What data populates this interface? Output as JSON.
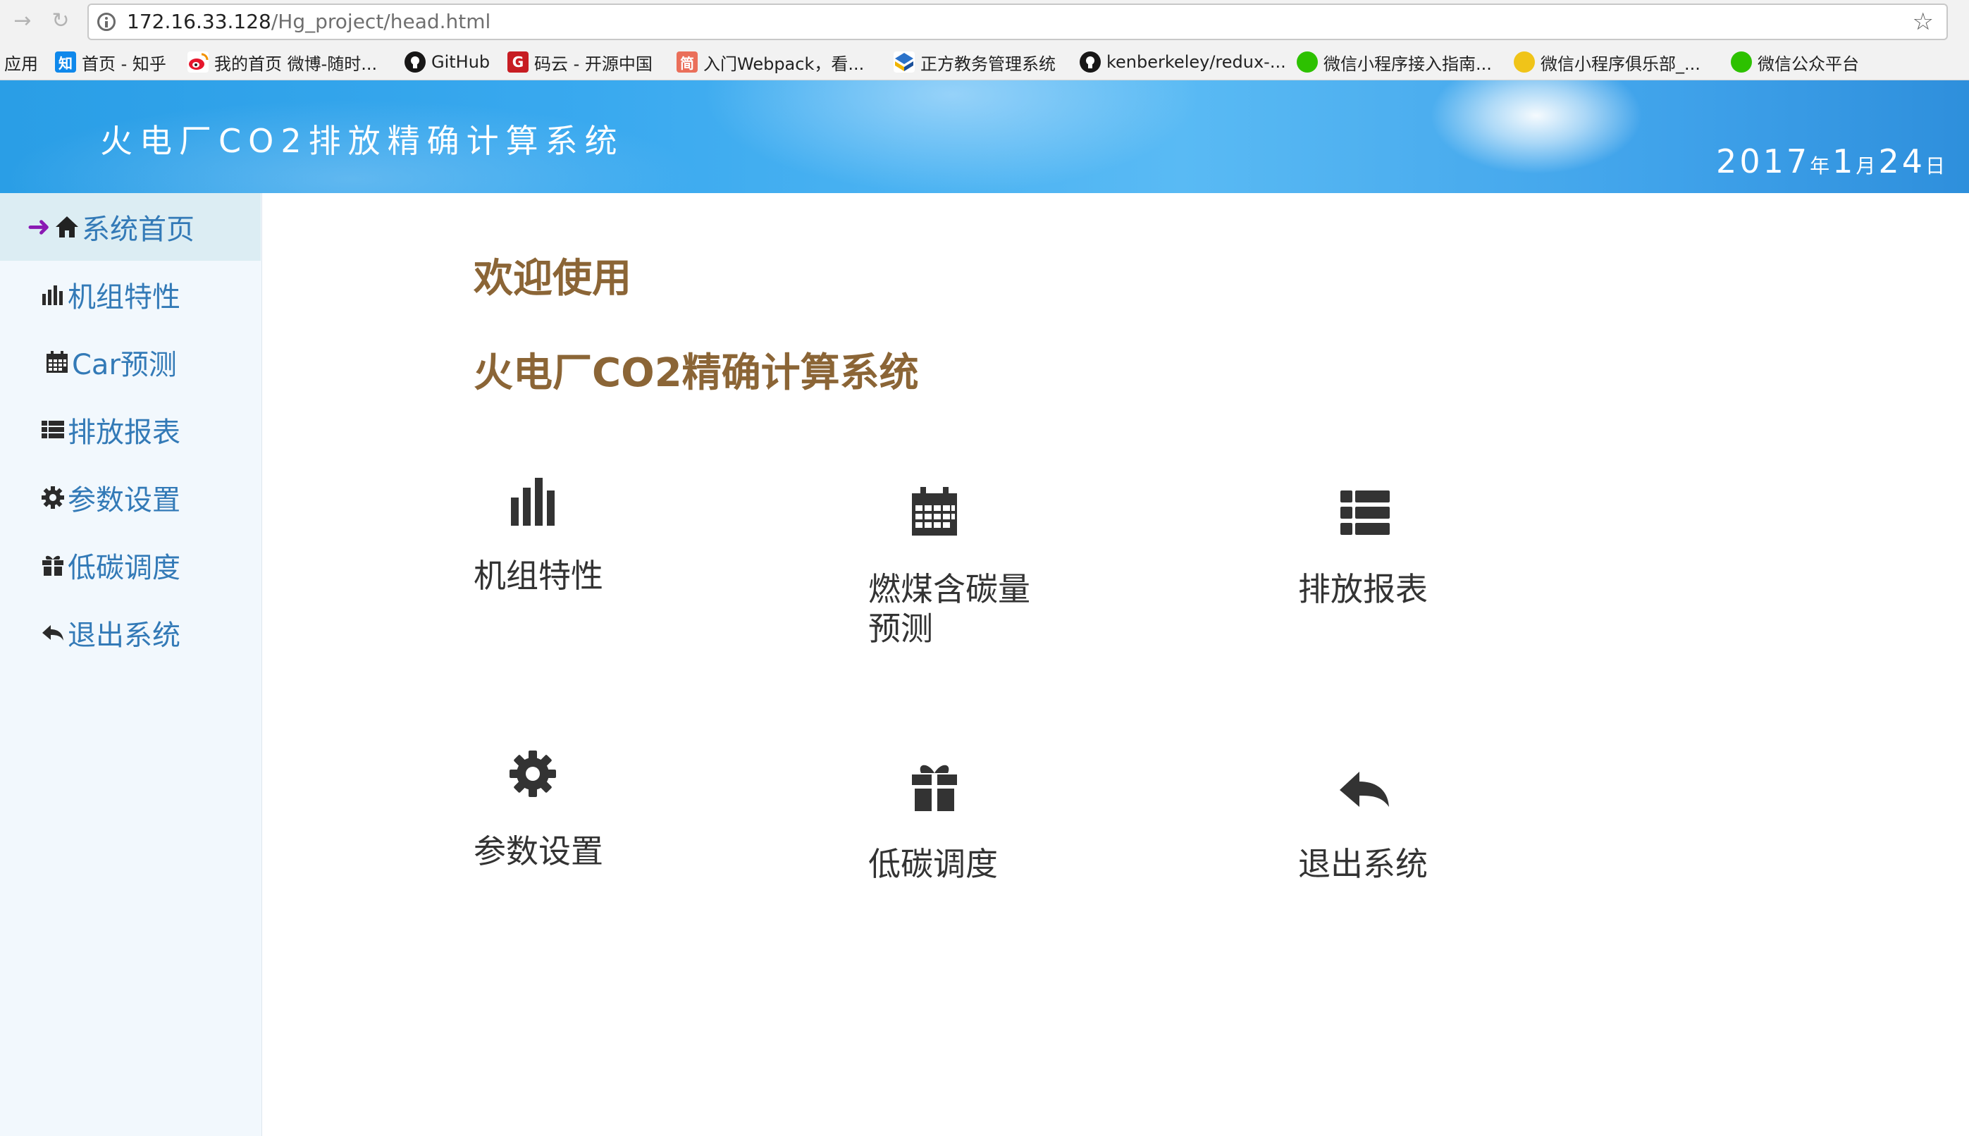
{
  "browser": {
    "url_host": "172.16.33.128",
    "url_path": "/Hg_project/head.html",
    "bookmarks": [
      {
        "label": "应用",
        "icon": "apps-grid-icon"
      },
      {
        "label": "首页 - 知乎",
        "icon": "zhihu-icon",
        "color": "#0f88eb"
      },
      {
        "label": "我的首页 微博-随时...",
        "icon": "weibo-icon",
        "color": "#e6162d"
      },
      {
        "label": "GitHub",
        "icon": "github-icon",
        "color": "#181717"
      },
      {
        "label": "码云 - 开源中国",
        "icon": "gitee-icon",
        "color": "#c71d23"
      },
      {
        "label": "入门Webpack，看...",
        "icon": "jianshu-icon",
        "color": "#ea6f5a"
      },
      {
        "label": "正方教务管理系统",
        "icon": "zhengfang-icon",
        "color": "#2b72c9"
      },
      {
        "label": "kenberkeley/redux-...",
        "icon": "github-icon",
        "color": "#181717"
      },
      {
        "label": "微信小程序接入指南...",
        "icon": "wechat-icon",
        "color": "#2dc100"
      },
      {
        "label": "微信小程序俱乐部_...",
        "icon": "club-icon",
        "color": "#f0c419"
      },
      {
        "label": "微信公众平台",
        "icon": "wechat-icon",
        "color": "#2dc100"
      }
    ]
  },
  "header": {
    "title": "火电厂CO2排放精确计算系统",
    "date": {
      "year": "2017",
      "year_unit": "年",
      "month": "1",
      "month_unit": "月",
      "day": "24",
      "day_unit": "日"
    }
  },
  "sidebar": {
    "items": [
      {
        "label": "系统首页",
        "icon": "home-icon",
        "active": true
      },
      {
        "label": "机组特性",
        "icon": "bar-chart-icon"
      },
      {
        "label": "Car预测",
        "icon": "calendar-icon"
      },
      {
        "label": "排放报表",
        "icon": "list-icon"
      },
      {
        "label": "参数设置",
        "icon": "cog-icon"
      },
      {
        "label": "低碳调度",
        "icon": "gift-icon"
      },
      {
        "label": "退出系统",
        "icon": "share-back-icon"
      }
    ]
  },
  "main": {
    "welcome": "欢迎使用",
    "system_title": "火电厂CO2精确计算系统",
    "tiles": [
      {
        "label": "机组特性",
        "icon": "bar-chart-icon"
      },
      {
        "label": "燃煤含碳量预测",
        "icon": "calendar-icon"
      },
      {
        "label": "排放报表",
        "icon": "list-icon"
      },
      {
        "label": "参数设置",
        "icon": "cog-icon"
      },
      {
        "label": "低碳调度",
        "icon": "gift-icon"
      },
      {
        "label": "退出系统",
        "icon": "share-back-icon"
      }
    ]
  }
}
